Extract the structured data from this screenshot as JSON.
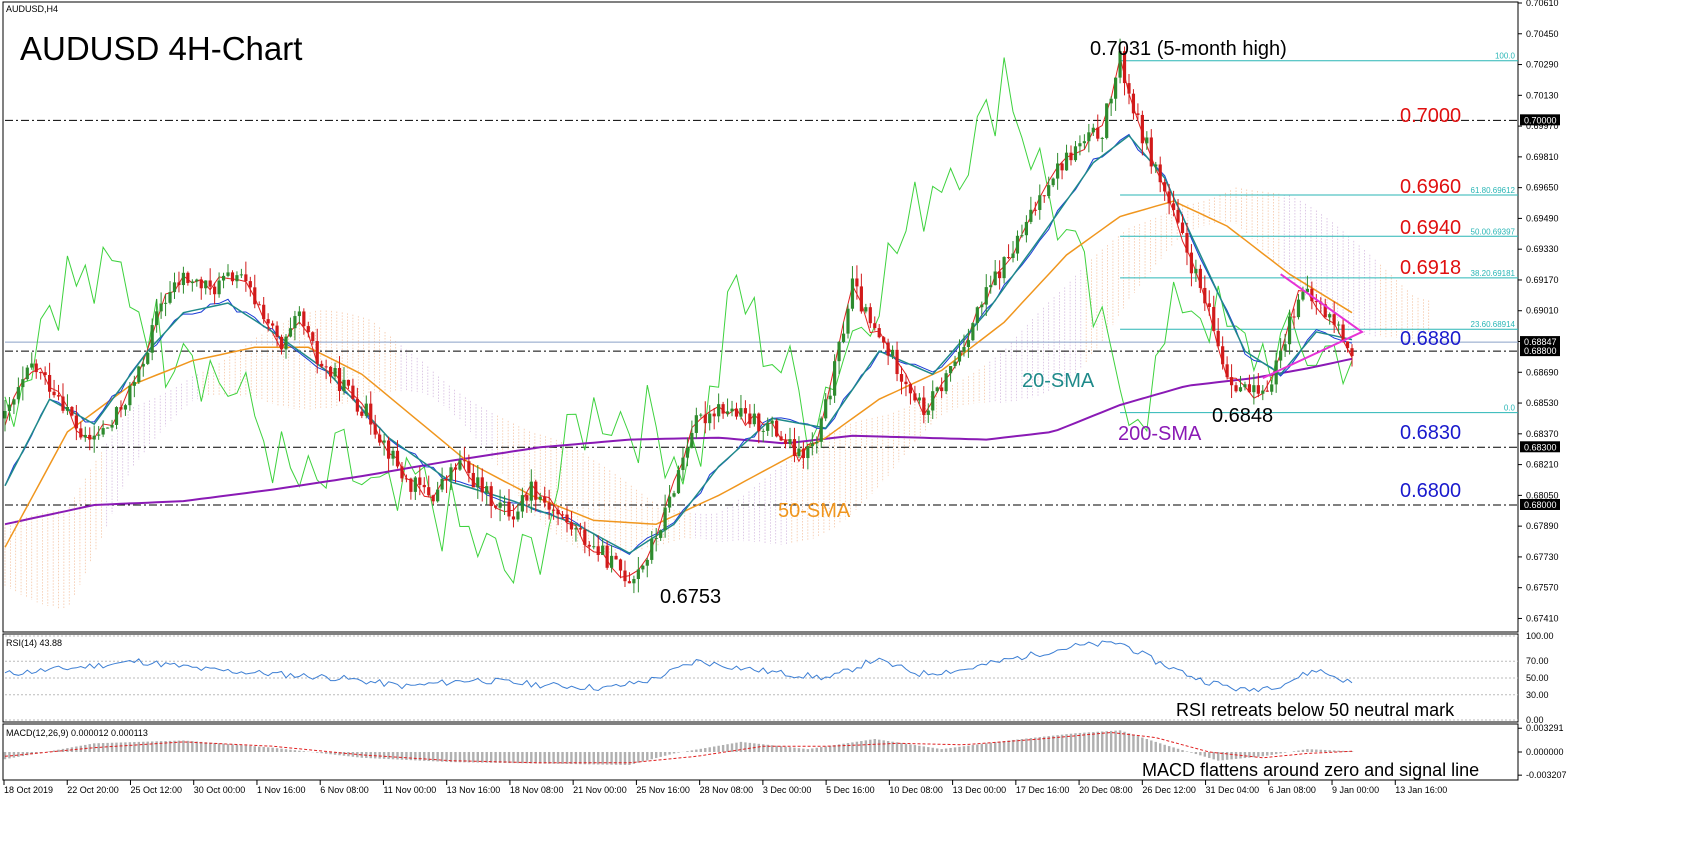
{
  "header": {
    "symbol_label": "AUDUSD,H4",
    "title": "AUDUSD 4H-Chart"
  },
  "colors": {
    "bull": "#2e8b2e",
    "bear": "#d11a1a",
    "sma20": "#1f8a8a",
    "sma50": "#f0961e",
    "sma200": "#8a1ab5",
    "tenkan": "#e02020",
    "kijun": "#1a3bd6",
    "chikou": "#3ed23e",
    "cloud_bull": "#f2b48a",
    "cloud_bear": "#c8a6d6",
    "triangle": "#e632d6",
    "fib": "#2ab6b6",
    "rsi": "#3d7fd4",
    "macd_hist": "#b0b0b0",
    "macd_signal": "#e02020",
    "label_red": "#e01010",
    "label_blue": "#1a1acd"
  },
  "chart_data": {
    "type": "line",
    "symbol": "AUDUSD",
    "timeframe": "H4",
    "ylim": [
      0.6735,
      0.7061
    ],
    "y_ticks": [
      "0.70610",
      "0.70450",
      "0.70290",
      "0.70130",
      "0.69970",
      "0.69810",
      "0.69650",
      "0.69490",
      "0.69330",
      "0.69170",
      "0.69010",
      "0.68850",
      "0.68690",
      "0.68530",
      "0.68370",
      "0.68210",
      "0.68050",
      "0.67890",
      "0.67730",
      "0.67570",
      "0.67410"
    ],
    "x_ticks": [
      "18 Oct 2019",
      "22 Oct 20:00",
      "25 Oct 12:00",
      "30 Oct 00:00",
      "1 Nov 16:00",
      "6 Nov 08:00",
      "11 Nov 00:00",
      "13 Nov 16:00",
      "18 Nov 08:00",
      "21 Nov 00:00",
      "25 Nov 16:00",
      "28 Nov 08:00",
      "3 Dec 00:00",
      "5 Dec 16:00",
      "10 Dec 08:00",
      "13 Dec 00:00",
      "17 Dec 16:00",
      "20 Dec 08:00",
      "26 Dec 12:00",
      "31 Dec 04:00",
      "6 Jan 08:00",
      "9 Jan 00:00",
      "13 Jan 16:00"
    ],
    "price_path": [
      [
        0,
        0.6845
      ],
      [
        6,
        0.6872
      ],
      [
        12,
        0.6858
      ],
      [
        18,
        0.6832
      ],
      [
        24,
        0.6842
      ],
      [
        30,
        0.6868
      ],
      [
        35,
        0.6905
      ],
      [
        40,
        0.6918
      ],
      [
        46,
        0.6912
      ],
      [
        52,
        0.692
      ],
      [
        58,
        0.69
      ],
      [
        62,
        0.688
      ],
      [
        66,
        0.6898
      ],
      [
        70,
        0.6875
      ],
      [
        76,
        0.6862
      ],
      [
        82,
        0.6845
      ],
      [
        90,
        0.6812
      ],
      [
        96,
        0.6805
      ],
      [
        102,
        0.6822
      ],
      [
        108,
        0.6805
      ],
      [
        114,
        0.6795
      ],
      [
        118,
        0.681
      ],
      [
        124,
        0.6795
      ],
      [
        130,
        0.6782
      ],
      [
        136,
        0.677
      ],
      [
        140,
        0.6762
      ],
      [
        144,
        0.6773
      ],
      [
        148,
        0.6795
      ],
      [
        154,
        0.684
      ],
      [
        160,
        0.6852
      ],
      [
        166,
        0.6845
      ],
      [
        172,
        0.684
      ],
      [
        178,
        0.6825
      ],
      [
        182,
        0.6832
      ],
      [
        186,
        0.687
      ],
      [
        190,
        0.6915
      ],
      [
        194,
        0.6893
      ],
      [
        198,
        0.688
      ],
      [
        202,
        0.6865
      ],
      [
        206,
        0.6848
      ],
      [
        210,
        0.6862
      ],
      [
        214,
        0.688
      ],
      [
        218,
        0.69
      ],
      [
        222,
        0.6918
      ],
      [
        228,
        0.694
      ],
      [
        234,
        0.697
      ],
      [
        240,
        0.6985
      ],
      [
        246,
        0.6995
      ],
      [
        250,
        0.7031
      ],
      [
        254,
        0.6998
      ],
      [
        258,
        0.6975
      ],
      [
        262,
        0.695
      ],
      [
        266,
        0.6925
      ],
      [
        270,
        0.6898
      ],
      [
        274,
        0.6868
      ],
      [
        278,
        0.686
      ],
      [
        282,
        0.6855
      ],
      [
        286,
        0.688
      ],
      [
        290,
        0.691
      ],
      [
        294,
        0.6905
      ],
      [
        298,
        0.6895
      ],
      [
        302,
        0.688
      ]
    ],
    "path_x_max": 302,
    "sma20": [
      [
        0,
        0.681
      ],
      [
        10,
        0.6855
      ],
      [
        20,
        0.6842
      ],
      [
        32,
        0.688
      ],
      [
        40,
        0.69
      ],
      [
        50,
        0.6905
      ],
      [
        60,
        0.689
      ],
      [
        72,
        0.687
      ],
      [
        86,
        0.6835
      ],
      [
        100,
        0.6812
      ],
      [
        114,
        0.6802
      ],
      [
        128,
        0.679
      ],
      [
        140,
        0.6775
      ],
      [
        150,
        0.679
      ],
      [
        160,
        0.682
      ],
      [
        172,
        0.6845
      ],
      [
        184,
        0.684
      ],
      [
        196,
        0.688
      ],
      [
        208,
        0.6868
      ],
      [
        220,
        0.69
      ],
      [
        234,
        0.6945
      ],
      [
        244,
        0.6978
      ],
      [
        252,
        0.6992
      ],
      [
        260,
        0.697
      ],
      [
        270,
        0.692
      ],
      [
        278,
        0.688
      ],
      [
        286,
        0.6868
      ],
      [
        294,
        0.689
      ],
      [
        302,
        0.6886
      ]
    ],
    "sma50": [
      [
        0,
        0.6778
      ],
      [
        14,
        0.6838
      ],
      [
        28,
        0.6862
      ],
      [
        42,
        0.6875
      ],
      [
        56,
        0.6882
      ],
      [
        68,
        0.6882
      ],
      [
        80,
        0.6868
      ],
      [
        92,
        0.6845
      ],
      [
        104,
        0.6822
      ],
      [
        118,
        0.6805
      ],
      [
        132,
        0.6792
      ],
      [
        146,
        0.679
      ],
      [
        160,
        0.6805
      ],
      [
        172,
        0.682
      ],
      [
        184,
        0.6835
      ],
      [
        196,
        0.6855
      ],
      [
        210,
        0.687
      ],
      [
        224,
        0.6895
      ],
      [
        238,
        0.693
      ],
      [
        250,
        0.695
      ],
      [
        262,
        0.6958
      ],
      [
        274,
        0.6945
      ],
      [
        288,
        0.692
      ],
      [
        302,
        0.69
      ]
    ],
    "sma200": [
      [
        0,
        0.679
      ],
      [
        20,
        0.68
      ],
      [
        40,
        0.6802
      ],
      [
        60,
        0.6808
      ],
      [
        80,
        0.6815
      ],
      [
        100,
        0.6823
      ],
      [
        120,
        0.683
      ],
      [
        140,
        0.6834
      ],
      [
        160,
        0.6835
      ],
      [
        175,
        0.6832
      ],
      [
        190,
        0.6836
      ],
      [
        205,
        0.6835
      ],
      [
        220,
        0.6834
      ],
      [
        235,
        0.6838
      ],
      [
        250,
        0.6852
      ],
      [
        265,
        0.6862
      ],
      [
        280,
        0.6866
      ],
      [
        292,
        0.6871
      ],
      [
        302,
        0.6876
      ]
    ],
    "fibonacci": [
      {
        "label": "100.0",
        "value": 0.7031
      },
      {
        "label": "61.80.69612",
        "value": 0.69612
      },
      {
        "label": "50.00.69397",
        "value": 0.69397
      },
      {
        "label": "38.20.69181",
        "value": 0.69181
      },
      {
        "label": "23.60.68914",
        "value": 0.68914
      },
      {
        "label": "0.0",
        "value": 0.6848
      }
    ],
    "levels": [
      {
        "value": 0.7,
        "label": "0.7000",
        "color": "red"
      },
      {
        "value": 0.688,
        "label": "0.6880",
        "color": "blue"
      },
      {
        "value": 0.683,
        "label": "0.6830",
        "color": "blue"
      },
      {
        "value": 0.68,
        "label": "0.6800",
        "color": "blue"
      }
    ],
    "price_boxes": [
      "0.70000",
      "0.68847",
      "0.68800",
      "0.68300",
      "0.68000"
    ],
    "current_price": 0.68847,
    "rsi": {
      "label": "RSI(14) 43.88",
      "ylim": [
        0,
        100
      ],
      "y_ticks": [
        "100.00",
        "70.00",
        "50.00",
        "30.00",
        "0.00"
      ],
      "values": [
        [
          0,
          55
        ],
        [
          15,
          62
        ],
        [
          30,
          70
        ],
        [
          45,
          60
        ],
        [
          60,
          55
        ],
        [
          75,
          50
        ],
        [
          90,
          40
        ],
        [
          105,
          48
        ],
        [
          120,
          42
        ],
        [
          135,
          38
        ],
        [
          145,
          48
        ],
        [
          155,
          70
        ],
        [
          165,
          62
        ],
        [
          175,
          55
        ],
        [
          185,
          50
        ],
        [
          195,
          72
        ],
        [
          205,
          55
        ],
        [
          215,
          60
        ],
        [
          225,
          72
        ],
        [
          240,
          88
        ],
        [
          250,
          92
        ],
        [
          258,
          70
        ],
        [
          268,
          48
        ],
        [
          278,
          35
        ],
        [
          286,
          42
        ],
        [
          294,
          60
        ],
        [
          302,
          44
        ]
      ]
    },
    "macd": {
      "label": "MACD(12,26,9) 0.000012 0.000113",
      "ylim": [
        -0.0036,
        0.0036
      ],
      "y_ticks": [
        "0.003291",
        "0.000000",
        "-0.003207"
      ],
      "histogram": [
        [
          0,
          -0.001
        ],
        [
          20,
          0.0012
        ],
        [
          40,
          0.0016
        ],
        [
          60,
          0.0006
        ],
        [
          80,
          -0.0008
        ],
        [
          100,
          -0.0014
        ],
        [
          120,
          -0.0016
        ],
        [
          140,
          -0.0018
        ],
        [
          150,
          -0.0002
        ],
        [
          165,
          0.0014
        ],
        [
          180,
          0.0004
        ],
        [
          195,
          0.0018
        ],
        [
          210,
          0.0004
        ],
        [
          225,
          0.0016
        ],
        [
          240,
          0.0026
        ],
        [
          250,
          0.003
        ],
        [
          260,
          0.001
        ],
        [
          272,
          -0.0012
        ],
        [
          282,
          -0.0006
        ],
        [
          292,
          0.0004
        ],
        [
          302,
          0.0001
        ]
      ],
      "signal": [
        [
          0,
          -0.0006
        ],
        [
          20,
          0.0006
        ],
        [
          40,
          0.0014
        ],
        [
          60,
          0.0008
        ],
        [
          80,
          -0.0004
        ],
        [
          100,
          -0.0012
        ],
        [
          120,
          -0.0015
        ],
        [
          140,
          -0.0015
        ],
        [
          155,
          -0.0006
        ],
        [
          170,
          0.0008
        ],
        [
          185,
          0.0008
        ],
        [
          200,
          0.0012
        ],
        [
          215,
          0.001
        ],
        [
          232,
          0.0018
        ],
        [
          248,
          0.0027
        ],
        [
          258,
          0.002
        ],
        [
          270,
          0.0
        ],
        [
          282,
          -0.0008
        ],
        [
          292,
          -0.0002
        ],
        [
          302,
          0.0001
        ]
      ]
    },
    "annotations": {
      "high": "0.7031 (5-month high)",
      "low_nov": "0.6753",
      "low_jan": "0.6848",
      "sma20": "20-SMA",
      "sma50": "50-SMA",
      "sma200": "200-SMA",
      "fib_0618": "0.6960",
      "fib_05": "0.6940",
      "fib_0382": "0.6918",
      "rsi_note": "RSI retreats below 50 neutral mark",
      "macd_note": "MACD flattens around zero and signal line"
    }
  }
}
